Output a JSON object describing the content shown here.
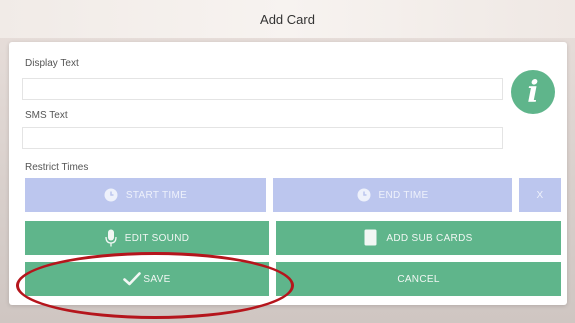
{
  "window": {
    "title": "Add Card"
  },
  "form": {
    "display_text_label": "Display Text",
    "display_text_value": "",
    "sms_text_label": "SMS Text",
    "sms_text_value": "",
    "restrict_times_label": "Restrict Times"
  },
  "buttons": {
    "start_time": "START TIME",
    "end_time": "END TIME",
    "clear_time": "X",
    "edit_sound": "EDIT SOUND",
    "add_sub_cards": "ADD SUB CARDS",
    "save": "SAVE",
    "cancel": "CANCEL"
  },
  "icons": {
    "info": "info-icon",
    "start_time": "clock-icon",
    "end_time": "clock-icon",
    "edit_sound": "microphone-icon",
    "add_sub_cards": "cards-icon",
    "save": "checkmark-icon"
  },
  "colors": {
    "primary_green": "#5fb58b",
    "time_button_blue": "#bcc6ee",
    "annotation_red": "#b5151c"
  }
}
